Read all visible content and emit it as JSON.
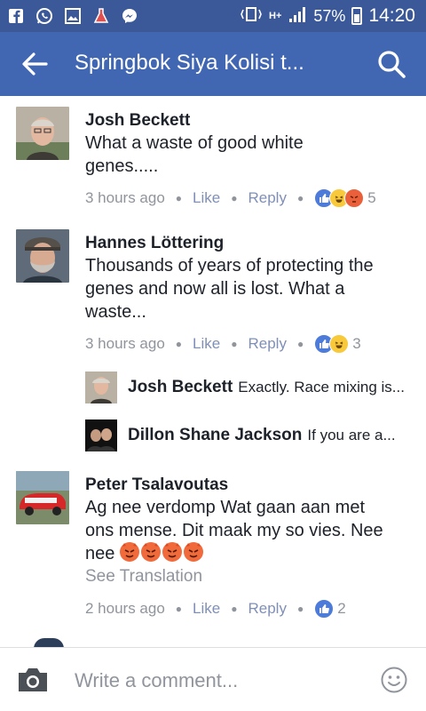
{
  "status_bar": {
    "left_icons": [
      "facebook-f-icon",
      "whatsapp-icon",
      "gallery-icon",
      "flask-icon",
      "messenger-icon"
    ],
    "network": "H+",
    "battery": "57%",
    "time": "14:20"
  },
  "header": {
    "title": "Springbok Siya Kolisi t...",
    "back_icon": "back-arrow-icon",
    "search_icon": "search-icon",
    "background": "#4267b2"
  },
  "comments": [
    {
      "name": "Josh Beckett",
      "text_lines": [
        "What a waste of good white",
        "genes....."
      ],
      "time": "3 hours ago",
      "like_label": "Like",
      "reply_label": "Reply",
      "reactions": [
        "like",
        "haha",
        "angry"
      ],
      "reaction_count": "5"
    },
    {
      "name": "Hannes Löttering",
      "text_lines": [
        "Thousands of years of protecting the",
        "genes and now all is lost. What a",
        "waste..."
      ],
      "time": "3 hours ago",
      "like_label": "Like",
      "reply_label": "Reply",
      "reactions": [
        "like",
        "haha"
      ],
      "reaction_count": "3",
      "replies": [
        {
          "name": "Josh Beckett",
          "text": "Exactly.  Race mixing is..."
        },
        {
          "name": "Dillon Shane Jackson",
          "text": "If you are a..."
        }
      ]
    },
    {
      "name": "Peter Tsalavoutas",
      "text_lines": [
        "Ag nee verdomp Wat gaan aan met",
        "ons mense. Dit maak my so vies. Nee",
        "nee"
      ],
      "see_translation": "See Translation",
      "time": "2 hours ago",
      "like_label": "Like",
      "reply_label": "Reply",
      "reactions": [
        "like"
      ],
      "reaction_count": "2"
    }
  ],
  "composer": {
    "placeholder": "Write a comment...",
    "camera_icon": "camera-icon",
    "emoji_icon": "smiley-icon"
  },
  "colors": {
    "status_bar": "#3b5998",
    "link_meta": "#90949c",
    "like_blue": "#4c7bd9"
  }
}
